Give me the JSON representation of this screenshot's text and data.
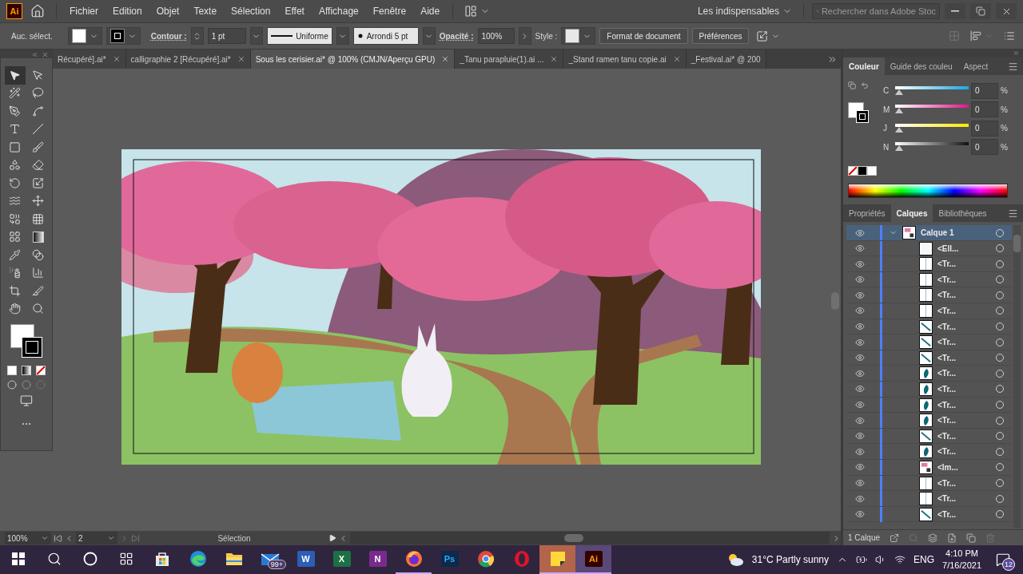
{
  "app": {
    "logo": "Ai",
    "menus": [
      "Fichier",
      "Edition",
      "Objet",
      "Texte",
      "Sélection",
      "Effet",
      "Affichage",
      "Fenêtre",
      "Aide"
    ],
    "workspace": "Les indispensables",
    "search": {
      "placeholder": "Rechercher dans Adobe Stoc"
    }
  },
  "control_bar": {
    "selection": "Auc. sélect.",
    "stroke_label": "Contour :",
    "stroke_weight": "1 pt",
    "profile": "Uniforme",
    "brush": "Arrondi 5 pt",
    "opacity_label": "Opacité :",
    "opacity": "100%",
    "style_label": "Style :",
    "buttons": [
      "Format de document",
      "Préférences"
    ]
  },
  "tabs": [
    {
      "label": "Récupéré].ai*",
      "selected": false
    },
    {
      "label": "calligraphie 2 [Récupéré].ai*",
      "selected": false
    },
    {
      "label": "Sous les cerisier.ai* @ 100% (CMJN/Aperçu GPU)",
      "selected": true
    },
    {
      "label": "_Tanu parapluie(1).ai ...",
      "selected": false
    },
    {
      "label": "_Stand ramen tanu copie.ai",
      "selected": false
    },
    {
      "label": "_Festival.ai* @ 200",
      "selected": false
    }
  ],
  "tools": [
    {
      "kind": "selection",
      "selected": true
    },
    {
      "kind": "direct",
      "selected": false
    },
    {
      "kind": "wand",
      "selected": false
    },
    {
      "kind": "lasso",
      "selected": false
    },
    {
      "kind": "pen",
      "selected": false
    },
    {
      "kind": "curvature",
      "selected": false
    },
    {
      "kind": "type",
      "selected": false
    },
    {
      "kind": "line",
      "selected": false
    },
    {
      "kind": "rectangle",
      "selected": false
    },
    {
      "kind": "brush",
      "selected": false
    },
    {
      "kind": "shaper",
      "selected": false
    },
    {
      "kind": "eraser",
      "selected": false
    },
    {
      "kind": "rotate",
      "selected": false
    },
    {
      "kind": "scale",
      "selected": false
    },
    {
      "kind": "warp",
      "selected": false
    },
    {
      "kind": "transform",
      "selected": false
    },
    {
      "kind": "builder",
      "selected": false
    },
    {
      "kind": "mesh",
      "selected": false
    },
    {
      "kind": "grid",
      "selected": false
    },
    {
      "kind": "gradient",
      "selected": false
    },
    {
      "kind": "eyedropper",
      "selected": false
    },
    {
      "kind": "blend",
      "selected": false
    },
    {
      "kind": "spray",
      "selected": false
    },
    {
      "kind": "graph",
      "selected": false
    },
    {
      "kind": "artboard",
      "selected": false
    },
    {
      "kind": "slice",
      "selected": false
    },
    {
      "kind": "hand",
      "selected": false
    },
    {
      "kind": "zoom",
      "selected": false
    }
  ],
  "color_panel": {
    "tabs": [
      {
        "label": "Couleur",
        "selected": true
      },
      {
        "label": "Guide des couleu",
        "selected": false
      },
      {
        "label": "Aspect",
        "selected": false
      }
    ],
    "sliders": [
      {
        "name": "C",
        "level": 0,
        "value": "0",
        "unit": "%"
      },
      {
        "name": "M",
        "level": 0,
        "value": "0",
        "unit": "%"
      },
      {
        "name": "J",
        "level": 0,
        "value": "0",
        "unit": "%"
      },
      {
        "name": "N",
        "level": 0,
        "value": "0",
        "unit": "%"
      }
    ]
  },
  "layers_panel": {
    "tabs": [
      {
        "label": "Propriétés",
        "selected": false
      },
      {
        "label": "Calques",
        "selected": true
      },
      {
        "label": "Bibliothèques",
        "selected": false
      }
    ],
    "layers": [
      {
        "name": "Calque 1",
        "selected": true,
        "expanded": true,
        "children": [
          {
            "name": "<Ell...",
            "selected": false,
            "kind": "blank"
          },
          {
            "name": "<Tr...",
            "selected": false,
            "kind": "line"
          },
          {
            "name": "<Tr...",
            "selected": false,
            "kind": "line"
          },
          {
            "name": "<Tr...",
            "selected": false,
            "kind": "line"
          },
          {
            "name": "<Tr...",
            "selected": false,
            "kind": "line"
          },
          {
            "name": "<Tr...",
            "selected": false,
            "kind": "stroke"
          },
          {
            "name": "<Tr...",
            "selected": false,
            "kind": "stroke"
          },
          {
            "name": "<Tr...",
            "selected": false,
            "kind": "stroke"
          },
          {
            "name": "<Tr...",
            "selected": false,
            "kind": "leaf"
          },
          {
            "name": "<Tr...",
            "selected": false,
            "kind": "leaf"
          },
          {
            "name": "<Tr...",
            "selected": false,
            "kind": "leaf"
          },
          {
            "name": "<Tr...",
            "selected": false,
            "kind": "leaf"
          },
          {
            "name": "<Tr...",
            "selected": false,
            "kind": "stroke"
          },
          {
            "name": "<Tr...",
            "selected": false,
            "kind": "leaf"
          },
          {
            "name": "<Im...",
            "selected": false
          },
          {
            "name": "<Tr...",
            "selected": false,
            "kind": "line"
          },
          {
            "name": "<Tr...",
            "selected": false,
            "kind": "line"
          },
          {
            "name": "<Tr...",
            "selected": false,
            "kind": "stroke"
          }
        ]
      }
    ],
    "footer": "1 Calque"
  },
  "status_bar": {
    "zoom": "100%",
    "page": "2",
    "tool": "Sélection"
  },
  "taskbar": {
    "apps": [
      {
        "kind": "store",
        "running": false,
        "selected": false
      },
      {
        "kind": "edge",
        "running": false,
        "selected": false
      },
      {
        "kind": "explorer",
        "running": false,
        "selected": false
      },
      {
        "kind": "mail",
        "badge": "99+",
        "running": false,
        "selected": false
      },
      {
        "kind": "word",
        "glyph": "W",
        "running": false,
        "selected": false
      },
      {
        "kind": "excel",
        "glyph": "X",
        "running": false,
        "selected": false
      },
      {
        "kind": "onenote",
        "glyph": "N",
        "running": false,
        "selected": false
      },
      {
        "kind": "firefox",
        "running": true,
        "selected": false
      },
      {
        "kind": "photoshop",
        "glyph": "Ps",
        "running": false,
        "selected": false
      },
      {
        "kind": "chrome",
        "running": false,
        "selected": false
      },
      {
        "kind": "opera",
        "running": false,
        "selected": false
      },
      {
        "kind": "sticky",
        "running": true,
        "selected": true
      },
      {
        "kind": "illustrator",
        "glyph": "Ai",
        "running": true,
        "selected": true
      }
    ],
    "weather": "31°C  Partly sunny",
    "language": "ENG",
    "time": "4:10 PM",
    "date": "7/16/2021",
    "notifications": "12"
  }
}
